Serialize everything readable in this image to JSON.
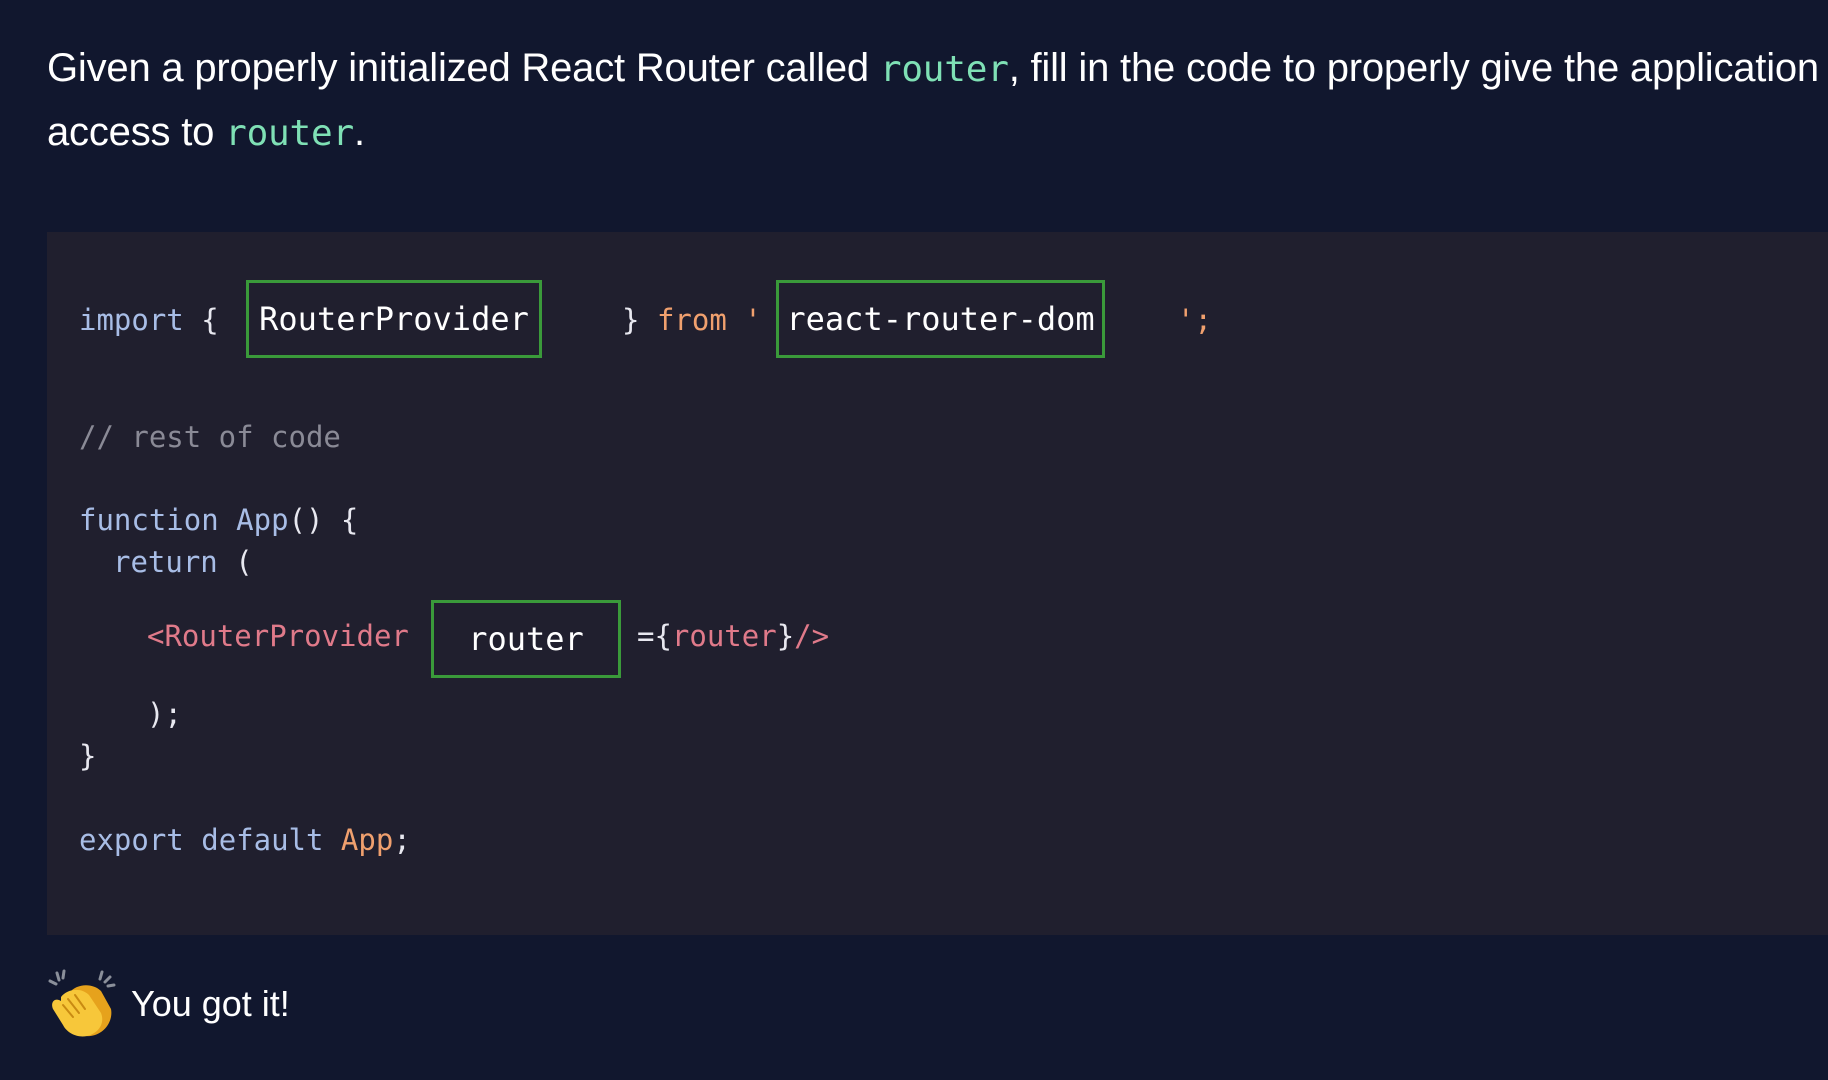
{
  "question": {
    "line1_pre": "Given a properly initialized React Router called ",
    "line1_code": "router",
    "line1_post": ", fill in the code to properly give the application",
    "line2_pre": "access to ",
    "line2_code": "router",
    "line2_post": "."
  },
  "code": {
    "import_kw": "import",
    "brace_open": "{",
    "brace_close": "}",
    "from_kw": "from",
    "quote_open": "'",
    "quote_close_semicolon": "';",
    "comment": "// rest of code",
    "function_kw": "function",
    "app_name": "App",
    "fn_sig_rest": "() {",
    "return_kw": "return",
    "return_paren": "(",
    "jsx_open_tag": "<RouterProvider",
    "jsx_equals": "={",
    "jsx_router_ref": "router",
    "jsx_close": "}",
    "jsx_self_close": "/>",
    "close_paren_semicolon": ");",
    "closing_brace": "}",
    "export_kw": "export",
    "default_kw": "default",
    "export_app": "App",
    "export_semicolon": ";"
  },
  "answers": {
    "import_name": "RouterProvider",
    "module_name": "react-router-dom",
    "prop_name": "router"
  },
  "result": {
    "icon": "clapping-hands-icon",
    "text": "You got it!"
  },
  "colors": {
    "background": "#11172e",
    "code_background": "#201f2e",
    "answer_border": "#3a9a3a",
    "inline_code": "#7fe0b5"
  }
}
